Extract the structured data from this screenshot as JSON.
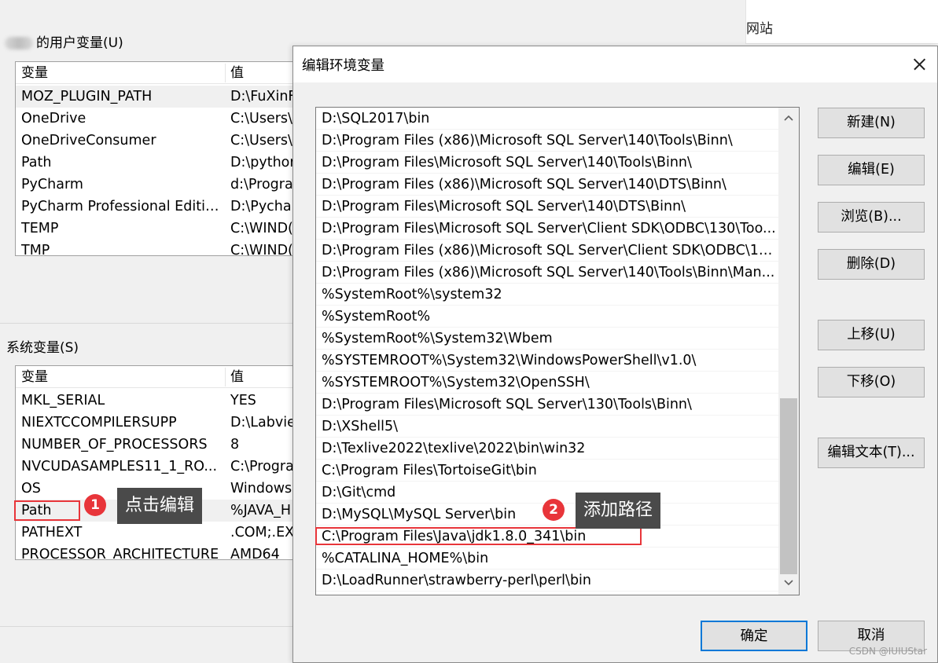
{
  "background": {
    "topright_text": "网站",
    "user_vars_label": "的用户变量(U)",
    "user_vars": {
      "headers": [
        "变量",
        "值"
      ],
      "rows": [
        [
          "MOZ_PLUGIN_PATH",
          "D:\\FuXinF"
        ],
        [
          "OneDrive",
          "C:\\Users\\"
        ],
        [
          "OneDriveConsumer",
          "C:\\Users\\"
        ],
        [
          "Path",
          "D:\\pythor"
        ],
        [
          "PyCharm",
          "d:\\Progra"
        ],
        [
          "PyCharm Professional Editio...",
          "D:\\Pychar"
        ],
        [
          "TEMP",
          "C:\\WIND("
        ],
        [
          "TMP",
          "C:\\WIND("
        ]
      ]
    },
    "system_vars_label": "系统变量(S)",
    "system_vars": {
      "headers": [
        "变量",
        "值"
      ],
      "rows": [
        [
          "MKL_SERIAL",
          "YES"
        ],
        [
          "NIEXTCCOMPILERSUPP",
          "D:\\Labvie"
        ],
        [
          "NUMBER_OF_PROCESSORS",
          "8"
        ],
        [
          "NVCUDASAMPLES11_1_RO...",
          "C:\\Progra"
        ],
        [
          "OS",
          "Windows"
        ],
        [
          "Path",
          "%JAVA_H"
        ],
        [
          "PATHEXT",
          ".COM;.EX"
        ],
        [
          "PROCESSOR_ARCHITECTURE",
          "AMD64"
        ]
      ]
    }
  },
  "annotations": {
    "badge1": "1",
    "callout1": "点击编辑",
    "badge2": "2",
    "callout2": "添加路径",
    "accent": "#e8353a"
  },
  "dialog": {
    "title": "编辑环境变量",
    "paths": [
      "D:\\SQL2017\\bin",
      "D:\\Program Files (x86)\\Microsoft SQL Server\\140\\Tools\\Binn\\",
      "D:\\Program Files\\Microsoft SQL Server\\140\\Tools\\Binn\\",
      "D:\\Program Files (x86)\\Microsoft SQL Server\\140\\DTS\\Binn\\",
      "D:\\Program Files\\Microsoft SQL Server\\140\\DTS\\Binn\\",
      "D:\\Program Files\\Microsoft SQL Server\\Client SDK\\ODBC\\130\\Too...",
      "D:\\Program Files (x86)\\Microsoft SQL Server\\Client SDK\\ODBC\\13...",
      "D:\\Program Files (x86)\\Microsoft SQL Server\\140\\Tools\\Binn\\Man...",
      "%SystemRoot%\\system32",
      "%SystemRoot%",
      "%SystemRoot%\\System32\\Wbem",
      "%SYSTEMROOT%\\System32\\WindowsPowerShell\\v1.0\\",
      "%SYSTEMROOT%\\System32\\OpenSSH\\",
      "D:\\Program Files\\Microsoft SQL Server\\130\\Tools\\Binn\\",
      "D:\\XShell5\\",
      "D:\\Texlive2022\\texlive\\2022\\bin\\win32",
      "C:\\Program Files\\TortoiseGit\\bin",
      "D:\\Git\\cmd",
      "D:\\MySQL\\MySQL Server\\bin",
      "C:\\Program Files\\Java\\jdk1.8.0_341\\bin",
      "%CATALINA_HOME%\\bin",
      "D:\\LoadRunner\\strawberry-perl\\perl\\bin"
    ],
    "buttons": {
      "new": "新建(N)",
      "edit": "编辑(E)",
      "browse": "浏览(B)...",
      "delete": "删除(D)",
      "move_up": "上移(U)",
      "move_down": "下移(O)",
      "edit_text": "编辑文本(T)...",
      "ok": "确定",
      "cancel": "取消"
    }
  },
  "watermark": "CSDN @IUIUStar"
}
